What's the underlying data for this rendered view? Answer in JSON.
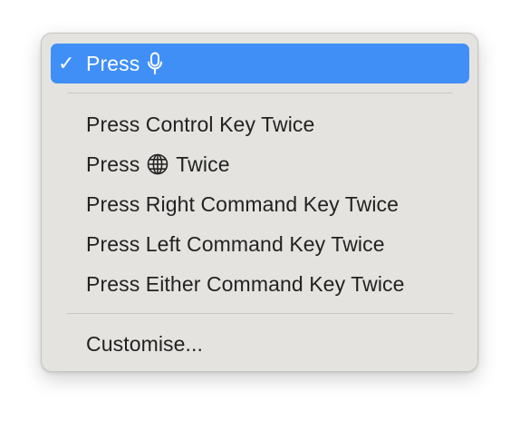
{
  "menu": {
    "selected_item": {
      "checkmark": "✓",
      "label": "Press",
      "icon": "microphone-icon"
    },
    "items": [
      {
        "label": "Press Control Key Twice"
      },
      {
        "label_before": "Press",
        "icon": "globe-icon",
        "label_after": "Twice"
      },
      {
        "label": "Press Right Command Key Twice"
      },
      {
        "label": "Press Left Command Key Twice"
      },
      {
        "label": "Press Either Command Key Twice"
      }
    ],
    "customise": {
      "label": "Customise..."
    }
  },
  "colors": {
    "menu_background": "#e4e3df",
    "selection": "#3f8ff7",
    "text": "#222222",
    "separator": "#c9c8c4"
  }
}
